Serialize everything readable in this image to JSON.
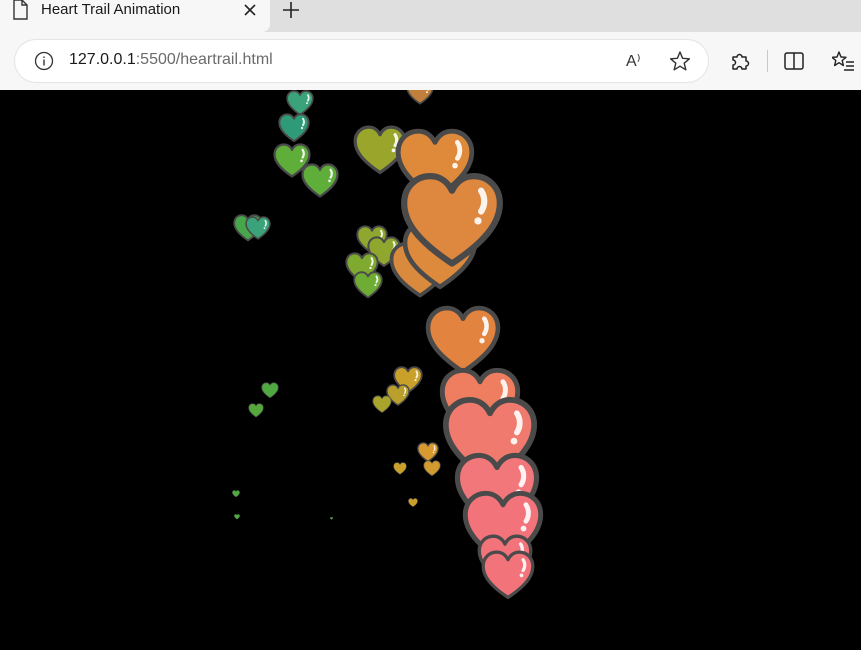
{
  "browser": {
    "tab": {
      "title": "Heart Trail Animation"
    },
    "address": {
      "host": "127.0.0.1",
      "rest": ":5500/heartrail.html"
    },
    "icons": {
      "tab": "document-icon",
      "close": "close-icon",
      "new_tab": "plus-icon",
      "info": "info-icon",
      "read_aloud": "read-aloud-icon",
      "favorite": "star-icon",
      "extensions": "puzzle-icon",
      "split": "split-screen-icon",
      "favorites": "favorites-icon"
    },
    "read_aloud_glyph": "A⁾"
  },
  "canvas": {
    "background": "#000000",
    "outline_color": "#4a4a4a",
    "hearts_count_note_colors": [
      "#3aa37a",
      "#5fae3a",
      "#a7a52c",
      "#c9a02a",
      "#e0863f",
      "#f07a6e",
      "#f2737a"
    ]
  }
}
